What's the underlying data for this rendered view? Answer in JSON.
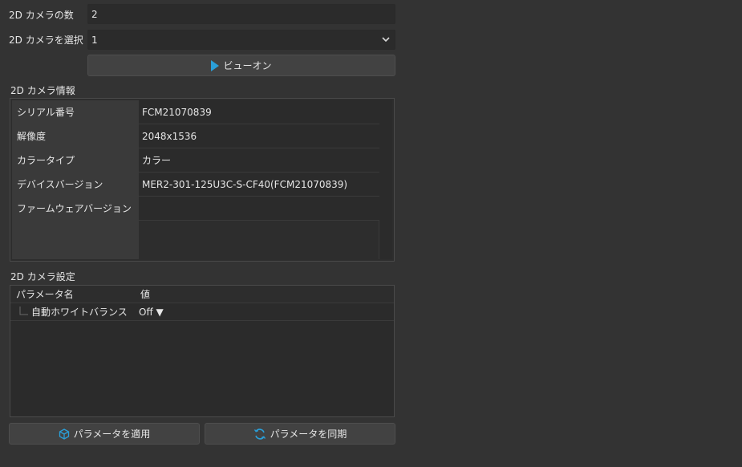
{
  "camera_count": {
    "label": "2D カメラの数",
    "value": "2"
  },
  "camera_select": {
    "label": "2D カメラを選択",
    "value": "1"
  },
  "view_button": {
    "label": "ビューオン"
  },
  "camera_info": {
    "title": "2D カメラ情報",
    "rows": [
      {
        "key": "シリアル番号",
        "value": "FCM21070839"
      },
      {
        "key": "解像度",
        "value": "2048x1536"
      },
      {
        "key": "カラータイプ",
        "value": "カラー"
      },
      {
        "key": "デバイスバージョン",
        "value": "MER2-301-125U3C-S-CF40(FCM21070839)"
      },
      {
        "key": "ファームウェアバージョン",
        "value": ""
      }
    ]
  },
  "camera_settings": {
    "title": "2D カメラ設定",
    "col_name": "パラメータ名",
    "col_value": "値",
    "rows": [
      {
        "name": "自動ホワイトバランス",
        "value": "Off ▼"
      }
    ]
  },
  "buttons": {
    "apply": "パラメータを適用",
    "sync": "パラメータを同期"
  },
  "colors": {
    "accent": "#2a9fd8",
    "background": "#333333"
  }
}
